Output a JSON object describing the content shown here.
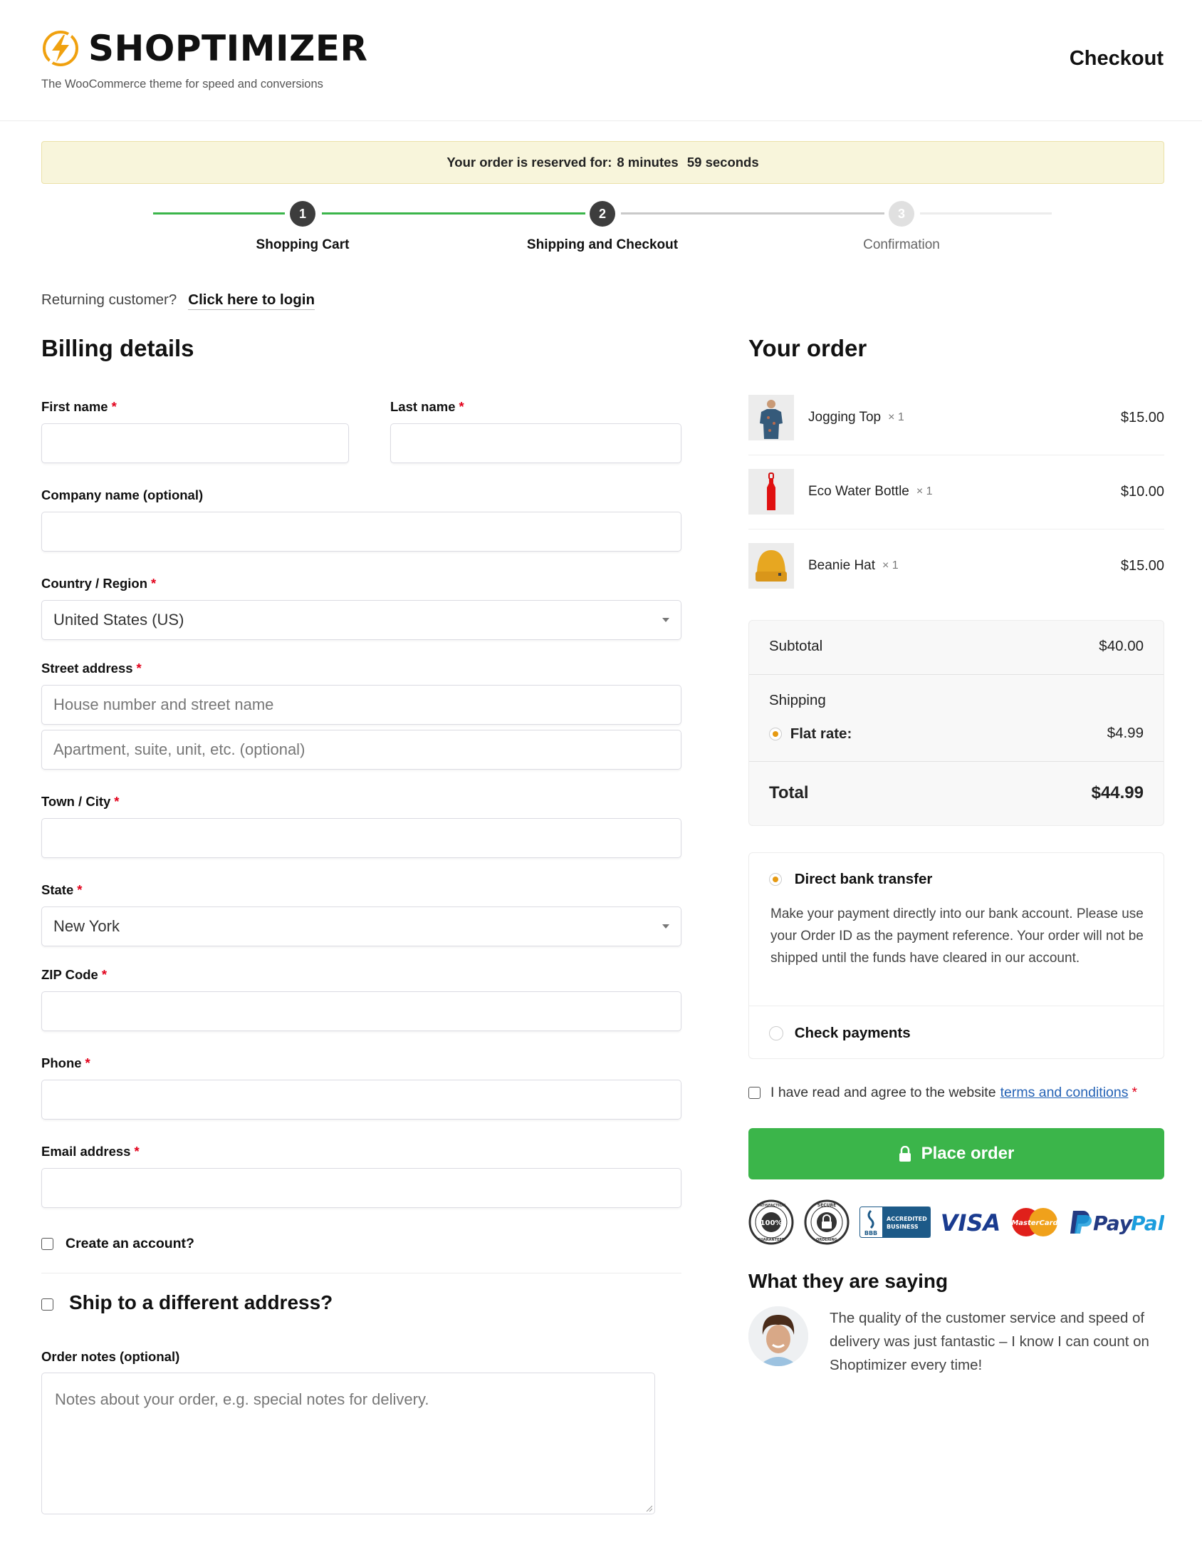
{
  "header": {
    "brand": "SHOPTIMIZER",
    "tagline": "The WooCommerce theme for speed and conversions",
    "page_title": "Checkout",
    "brand_color": "#f0a10f"
  },
  "notice": {
    "prefix": "Your order is reserved for:",
    "minutes": "8 minutes",
    "seconds": "59 seconds"
  },
  "steps": [
    {
      "number": "1",
      "label": "Shopping Cart",
      "state": "done"
    },
    {
      "number": "2",
      "label": "Shipping and Checkout",
      "state": "current"
    },
    {
      "number": "3",
      "label": "Confirmation",
      "state": "upcoming"
    }
  ],
  "login": {
    "prompt": "Returning customer?",
    "link": "Click here to login"
  },
  "billing": {
    "title": "Billing details",
    "fields": {
      "first_name": {
        "label": "First name",
        "value": ""
      },
      "last_name": {
        "label": "Last name",
        "value": ""
      },
      "company": {
        "label": "Company name (optional)",
        "value": ""
      },
      "country": {
        "label": "Country / Region",
        "value": "United States (US)"
      },
      "street": {
        "label": "Street address",
        "placeholder1": "House number and street name",
        "placeholder2": "Apartment, suite, unit, etc. (optional)"
      },
      "city": {
        "label": "Town / City",
        "value": ""
      },
      "state": {
        "label": "State",
        "value": "New York"
      },
      "zip": {
        "label": "ZIP Code",
        "value": ""
      },
      "phone": {
        "label": "Phone",
        "value": ""
      },
      "email": {
        "label": "Email address",
        "value": ""
      }
    },
    "required_mark": "*",
    "create_account": "Create an account?",
    "ship_different": "Ship to a different address?",
    "order_notes": {
      "label": "Order notes (optional)",
      "placeholder": "Notes about your order, e.g. special notes for delivery."
    }
  },
  "order": {
    "title": "Your order",
    "items": [
      {
        "name": "Jogging Top",
        "qty": "× 1",
        "price": "$15.00"
      },
      {
        "name": "Eco Water Bottle",
        "qty": "× 1",
        "price": "$10.00"
      },
      {
        "name": "Beanie Hat",
        "qty": "× 1",
        "price": "$15.00"
      }
    ],
    "subtotal_label": "Subtotal",
    "subtotal": "$40.00",
    "shipping_label": "Shipping",
    "shipping_method": "Flat rate:",
    "shipping_price": "$4.99",
    "total_label": "Total",
    "total": "$44.99"
  },
  "payment": {
    "methods": [
      {
        "label": "Direct bank transfer",
        "selected": true
      },
      {
        "label": "Check payments",
        "selected": false
      }
    ],
    "description": "Make your payment directly into our bank account. Please use your Order ID as the payment reference. Your order will not be shipped until the funds have cleared in our account."
  },
  "terms": {
    "text": "I have read and agree to the website",
    "link": "terms and conditions",
    "required_mark": "*"
  },
  "place_order": {
    "label": "Place order",
    "color": "#3bb54a"
  },
  "trust_badges": {
    "satisfaction_top": "SATISFACTION",
    "satisfaction_mid": "100%",
    "satisfaction_bottom": "GUARANTEED",
    "secure_top": "SECURE",
    "secure_bottom": "ORDERING",
    "bbb_line1": "ACCREDITED",
    "bbb_line2": "BUSINESS",
    "bbb_logo": "BBB",
    "visa": "VISA",
    "mastercard": "MasterCard",
    "paypal_1": "Pay",
    "paypal_2": "Pal"
  },
  "testimonial": {
    "title": "What they are saying",
    "quote": "The quality of the customer service and speed of delivery was just fantastic – I know I can count on Shoptimizer every time!"
  }
}
